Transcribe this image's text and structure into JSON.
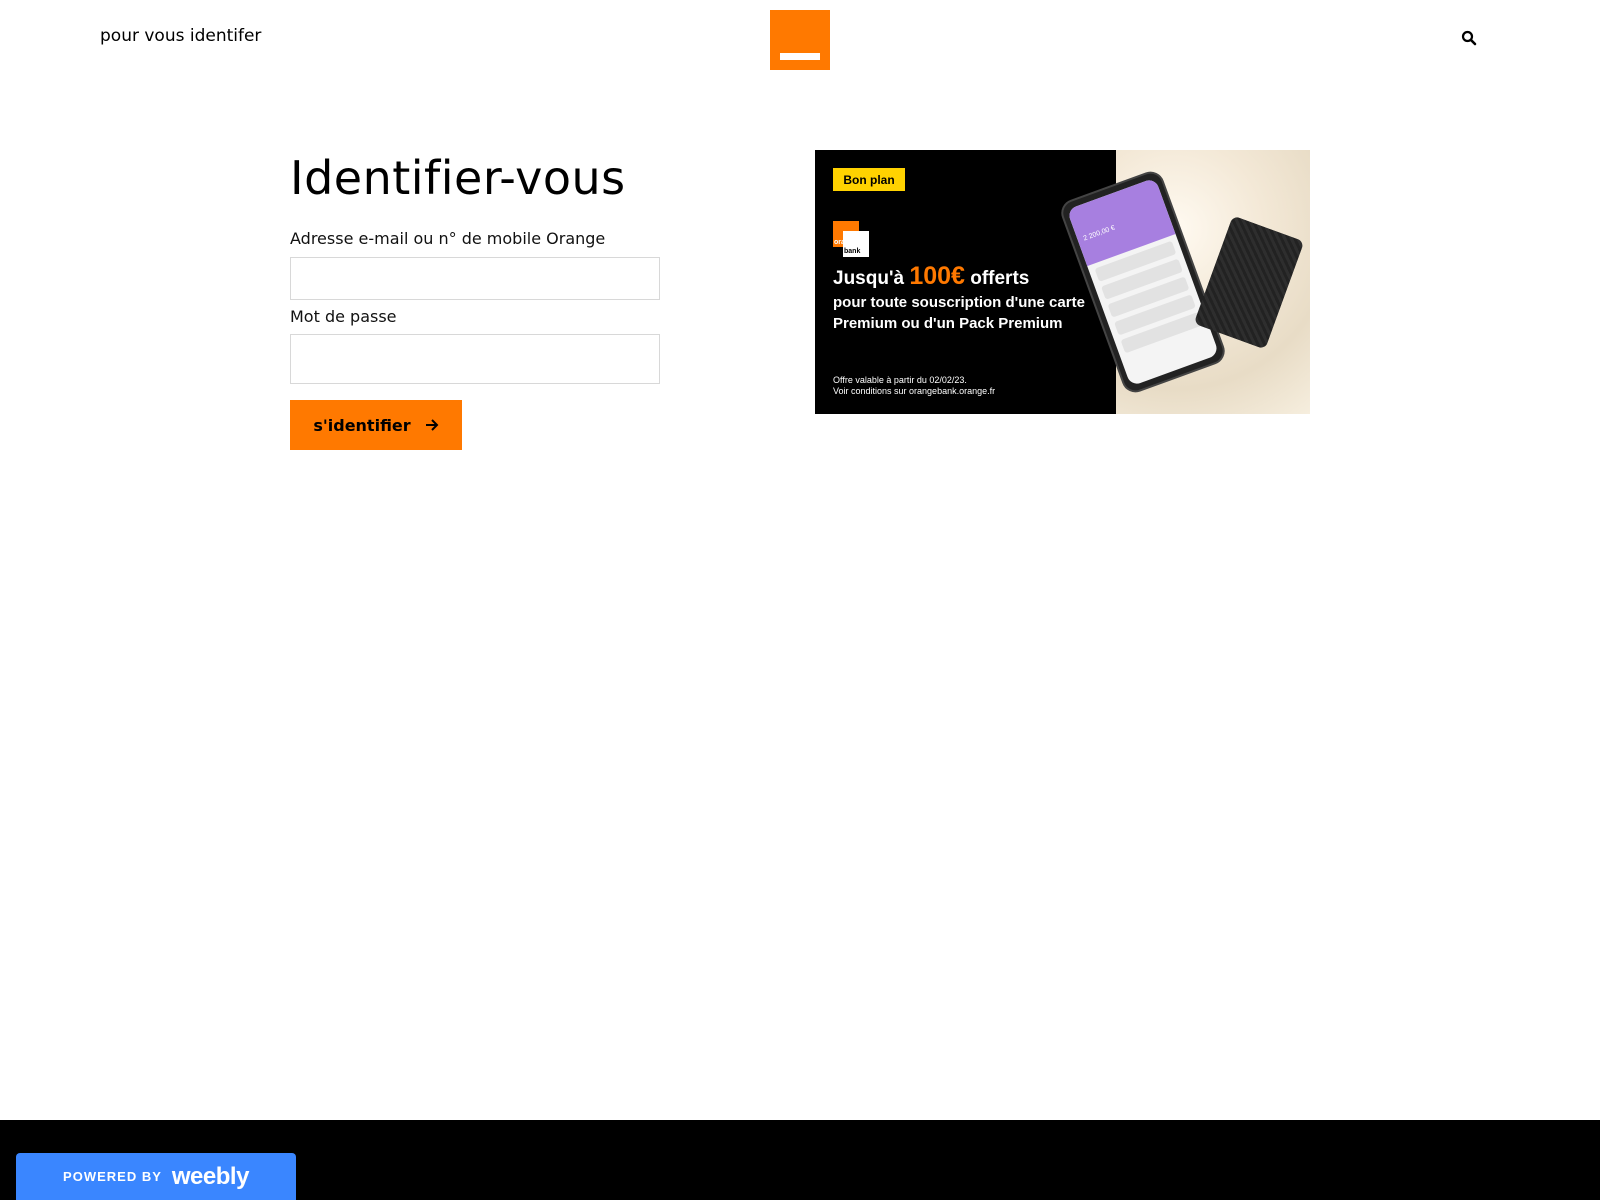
{
  "header": {
    "site_title": "pour vous identifer"
  },
  "login": {
    "heading": "Identifier-vous",
    "email_label": "Adresse e-mail ou n° de mobile Orange",
    "email_value": "",
    "password_label": "Mot de passe",
    "password_value": "",
    "submit_label": "s'identifier"
  },
  "promo": {
    "badge": "Bon plan",
    "logo_top": "orange",
    "logo_bottom": "bank",
    "headline_prefix": "Jusqu'à",
    "headline_amount": "100€",
    "headline_suffix": "offerts",
    "sub_line1": "pour toute souscription d'une carte",
    "sub_line2": "Premium ou d'un Pack Premium",
    "fine_line1": "Offre valable à partir du 02/02/23.",
    "fine_line2": "Voir conditions sur orangebank.orange.fr",
    "phone_screen_amount": "2 200,00 €"
  },
  "footer": {
    "powered_by": "POWERED BY",
    "brand": "weebly"
  },
  "colors": {
    "accent": "#ff7900",
    "weebly_blue": "#3a86ff",
    "badge_yellow": "#ffd200"
  },
  "icons": {
    "search": "search-icon",
    "arrow": "arrow-right-icon"
  }
}
